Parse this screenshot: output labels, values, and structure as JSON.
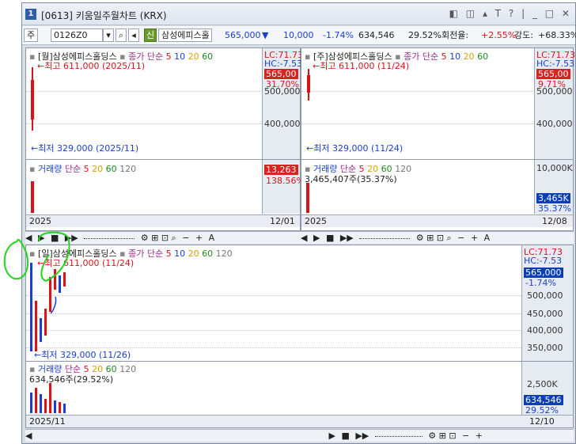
{
  "window": {
    "number": "1",
    "title": "[0613] 키움일주월차트 (KRX)",
    "controls": "◧ ◫ ▴ T ? | _ □ ✕"
  },
  "toolbar": {
    "market": "주",
    "code": "0126Z0",
    "badge": "신",
    "name": "삼성에피스홀",
    "price": "565,000",
    "change_arrow": "▼",
    "change": "10,000",
    "change_pct": "-1.74%",
    "volume": "634,546",
    "vol_ratio": "29.52%",
    "turnover_label": "회전율:",
    "turnover": "+2.55%",
    "strength_label": "강도:",
    "strength": "+68.33%"
  },
  "colors": {
    "up": "#d7141a",
    "down": "#1a3fd0",
    "accent": "#3050c8",
    "current_tag": "#0a3fb8",
    "prev_tag": "#d8231f"
  },
  "monthly": {
    "title": "[월]삼성에피스홀딩스",
    "ma_label": "종가 단순",
    "ma": [
      "5",
      "10",
      "20",
      "60"
    ],
    "lc": "LC:71.73",
    "hc": "HC:-7.53",
    "price_tag": "565,00",
    "pct_tag": "31.70%",
    "high": "최고 611,000 (2025/11)",
    "low": "←최저 329,000 (2025/11)",
    "y": [
      "500,000",
      "400,000"
    ],
    "vol_title": "거래량",
    "vol_ma_label": "단순",
    "vol_ma": [
      "5",
      "20",
      "60",
      "120"
    ],
    "vol_tag": "13,263",
    "vol_tag2": "138.56%",
    "date_left": "2025",
    "date_right": "12/01"
  },
  "weekly": {
    "title": "[주]삼성에피스홀딩스",
    "ma_label": "종가 단순",
    "ma": [
      "5",
      "10",
      "20",
      "60"
    ],
    "lc": "LC:71.73",
    "hc": "HC:-7.53",
    "price_tag": "565,00",
    "pct_tag": "9.71%",
    "high": "최고 611,000 (11/24)",
    "low": "←최저 329,000 (11/24)",
    "y": [
      "500,000",
      "400,000"
    ],
    "vol_title": "거래량",
    "vol_ma_label": "단순",
    "vol_ma": [
      "5",
      "20",
      "60",
      "120"
    ],
    "vol_count": "3,465,407주(35.37%)",
    "vol_y": "10,000K",
    "vol_tag": "3,465K",
    "vol_tag2": "35.37%",
    "date_left": "2025",
    "date_right": "12/08"
  },
  "daily": {
    "title": "[일]삼성에피스홀딩스",
    "ma_label": "종가 단순",
    "ma": [
      "5",
      "10",
      "20",
      "60",
      "120"
    ],
    "lc": "LC:71.73",
    "hc": "HC:-7.53",
    "price_tag": "565,000",
    "pct_tag": "-1.74%",
    "high": "최고 611,000 (11/24)",
    "low": "←최저 329,000 (11/26)",
    "y": [
      "500,000",
      "450,000",
      "400,000",
      "350,000"
    ],
    "vol_title": "거래량",
    "vol_ma_label": "단순",
    "vol_ma": [
      "5",
      "20",
      "60",
      "120"
    ],
    "vol_count": "634,546주(29.52%)",
    "vol_y": "2,500K",
    "vol_tag": "634,546",
    "vol_tag2": "29.52%",
    "date_left": "2025/11",
    "date_right": "12/10"
  },
  "nav": {
    "left": "◀",
    "right": "▶",
    "play": "▶",
    "stop": "■",
    "ff": "▶▶",
    "zoom_out": "−",
    "zoom_in": "+",
    "text": "A",
    "search": "🔍"
  }
}
